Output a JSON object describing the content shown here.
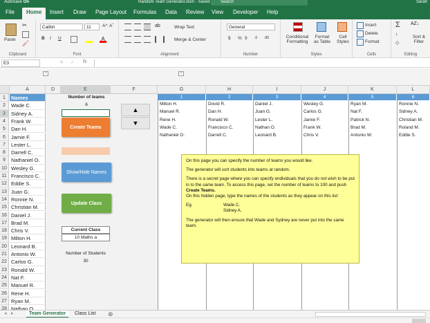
{
  "titlebar": {
    "autosave": "AutoSave",
    "autosave_state": "On",
    "doc_title": "Random Team Generator.xlsm - Saved",
    "search": "Search",
    "user": "Sarah"
  },
  "tabs": [
    "File",
    "Home",
    "Insert",
    "Draw",
    "Page Layout",
    "Formulas",
    "Data",
    "Review",
    "View",
    "Developer",
    "Help"
  ],
  "ribbon": {
    "clipboard": {
      "paste": "Paste",
      "label": "Clipboard"
    },
    "font": {
      "name": "Calibri",
      "size": "11",
      "label": "Font",
      "grow": "A^",
      "shrink": "Aˇ",
      "bold": "B",
      "italic": "I",
      "underline": "U"
    },
    "alignment": {
      "wrap": "Wrap Text",
      "merge": "Merge & Center",
      "label": "Alignment"
    },
    "number": {
      "format": "General",
      "currency": "$",
      "percent": "%",
      "comma": "9",
      "label": "Number"
    },
    "styles": {
      "conditional": "Conditional Formatting",
      "format_as_table": "Format as Table",
      "cell_styles": "Cell Styles",
      "label": "Styles"
    },
    "cells": {
      "insert": "Insert",
      "delete": "Delete",
      "format": "Format",
      "label": "Cells"
    },
    "editing": {
      "sum": "Σ",
      "sort": "Sort & Filter",
      "label": "Editing"
    }
  },
  "formulabar": {
    "namebox": "E3",
    "cancel": "✕",
    "enter": "✓",
    "fx": "fx",
    "value": ""
  },
  "columns": [
    "A",
    "D",
    "E",
    "F",
    "G",
    "H",
    "I",
    "J",
    "K",
    "L"
  ],
  "rows": [
    "1",
    "2",
    "3",
    "4",
    "5",
    "6",
    "7",
    "8",
    "9",
    "10",
    "11",
    "12",
    "13",
    "14",
    "15",
    "16",
    "17",
    "18",
    "19",
    "20",
    "21",
    "22",
    "23",
    "24",
    "25",
    "26",
    "27",
    "28"
  ],
  "names_header": "Names",
  "names": [
    "Wade C.",
    "Sidney A.",
    "Frank W.",
    "Dan H.",
    "Jamie F.",
    "Lester L.",
    "Darrell C.",
    "Nathaniel O.",
    "Wesley G.",
    "Francisco C.",
    "Eddie S.",
    "Juan G.",
    "Ronnie N.",
    "Christian M.",
    "Daniel J.",
    "Brad M.",
    "Chris V.",
    "Milton H.",
    "Leonard B.",
    "Antonio W.",
    "Carlos G.",
    "Ronald W.",
    "Nat F.",
    "Manuel R.",
    "Rene H.",
    "Ryan M.",
    "Nathan O."
  ],
  "panel": {
    "num_teams_label": "Number of teams",
    "num_teams_value": "6",
    "create_button": "Create Teams",
    "show_hide_button": "Show/Hide Names",
    "update_button": "Update Class",
    "current_class_label": "Current Class",
    "current_class_value": "10 Maths a",
    "num_students_label": "Number of Students",
    "num_students_value": "30",
    "up_arrow": "▲",
    "down_arrow": "▼"
  },
  "teams": [
    {
      "number": "1",
      "members": [
        "Milton H.",
        "Manuel R.",
        "Rene H.",
        "Wade C.",
        "Nathaniel O."
      ]
    },
    {
      "number": "2",
      "members": [
        "Dovid R.",
        "Dan H.",
        "Ronald W.",
        "Francisco C.",
        "Darrell C."
      ]
    },
    {
      "number": "3",
      "members": [
        "Daniel J.",
        "Juan G.",
        "Lester L.",
        "Nathan O.",
        "Leonard B."
      ]
    },
    {
      "number": "4",
      "members": [
        "Wesley G.",
        "Carlos G.",
        "Jamie F.",
        "Frank W.",
        "Chris V."
      ]
    },
    {
      "number": "5",
      "members": [
        "Ryan M.",
        "Nat F.",
        "Patrick N.",
        "Brad M.",
        "Antonio W."
      ]
    },
    {
      "number": "6",
      "members": [
        "Ronnie N.",
        "Sidney A.",
        "Christian M.",
        "Roland M.",
        "Eddie S."
      ]
    }
  ],
  "note": {
    "p1": "On this page you can specify the number of teams you would like.",
    "p2": "The generator will sort students into teams at random.",
    "p3a": "There is a secret page where you can specify endividuals that you do not wish to be put in to the same team. To access this page, set the number of teams to 100 and push ",
    "p3b": "Create Teams.",
    "p4": "On this hidden page, type the names of the students as they appear on this list:",
    "eg_label": "Eg.",
    "eg1": "Wade C.",
    "eg2": "Sidney A.",
    "p5": "The generator will then ensure that Wade and Sydney are never put into the same team."
  },
  "sheets": [
    "Team Generator",
    "Class List"
  ],
  "colors": {
    "excel_green": "#217346",
    "team_header": "#5b9bd5",
    "create_btn": "#ed7d31",
    "show_btn": "#5b9bd5",
    "update_btn": "#70ad47",
    "note_bg": "#ffff99"
  }
}
